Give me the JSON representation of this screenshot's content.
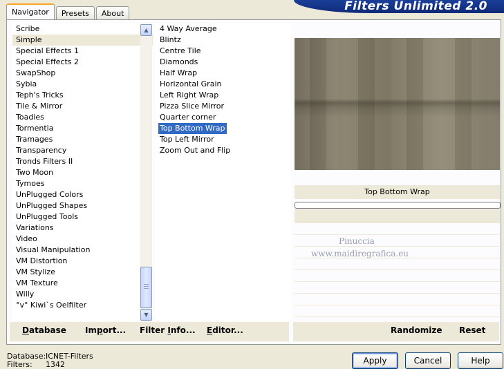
{
  "app": {
    "title": "Filters Unlimited 2.0",
    "tabs": [
      {
        "label": "Navigator",
        "active": true
      },
      {
        "label": "Presets",
        "active": false
      },
      {
        "label": "About",
        "active": false
      }
    ]
  },
  "categories": {
    "selected": "Simple",
    "items": [
      "Scribe",
      "Simple",
      "Special Effects 1",
      "Special Effects 2",
      "SwapShop",
      "Sybia",
      "Teph's Tricks",
      "Tile & Mirror",
      "Toadies",
      "Tormentia",
      "Tramages",
      "Transparency",
      "Tronds Filters II",
      "Two Moon",
      "Tymoes",
      "UnPlugged Colors",
      "UnPlugged Shapes",
      "UnPlugged Tools",
      "Variations",
      "Video",
      "Visual Manipulation",
      "VM Distortion",
      "VM Stylize",
      "VM Texture",
      "Willy",
      "°v° Kiwi`s Oelfilter"
    ]
  },
  "filters": {
    "selected": "Top Bottom Wrap",
    "items": [
      "4 Way Average",
      "Blintz",
      "Centre Tile",
      "Diamonds",
      "Half Wrap",
      "Horizontal Grain",
      "Left Right Wrap",
      "Pizza Slice Mirror",
      "Quarter corner",
      "Top Bottom Wrap",
      "Top Left Mirror",
      "Zoom Out and Flip"
    ]
  },
  "preview": {
    "filter_name": "Top Bottom Wrap",
    "watermark_line1": "Pinuccia",
    "watermark_line2": "www.maidiregrafica.eu"
  },
  "toolbar": {
    "database": {
      "pre": "",
      "u": "D",
      "post": "atabase"
    },
    "import": {
      "pre": "Im",
      "u": "p",
      "post": "ort..."
    },
    "filter_info": {
      "pre": "Filter ",
      "u": "I",
      "post": "nfo..."
    },
    "editor": {
      "pre": "",
      "u": "E",
      "post": "ditor..."
    },
    "randomize": "Randomize",
    "reset": "Reset"
  },
  "status": {
    "database_label": "Database:",
    "database_value": "ICNET-Filters",
    "filters_label": "Filters:",
    "filters_value": "1342"
  },
  "buttons": {
    "apply": "Apply",
    "cancel": "Cancel",
    "help": "Help"
  },
  "colors": {
    "selection": "#316ac5",
    "window_bg": "#ece9d8",
    "banner": "#1b3f99"
  }
}
